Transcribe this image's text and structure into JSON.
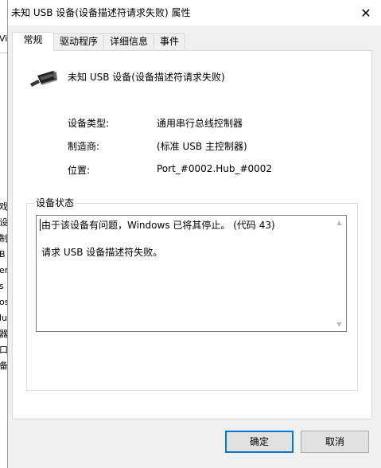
{
  "background_window": {
    "fragments": [
      "Vi",
      "戏",
      "设",
      "制",
      "B",
      "er",
      "s",
      "os",
      "lu",
      "器",
      "口",
      "备"
    ]
  },
  "window": {
    "title": "未知 USB 设备(设备描述符请求失败) 属性",
    "close_glyph": "✕"
  },
  "tabs": [
    {
      "label": "常规",
      "active": true
    },
    {
      "label": "驱动程序",
      "active": false
    },
    {
      "label": "详细信息",
      "active": false
    },
    {
      "label": "事件",
      "active": false
    }
  ],
  "device": {
    "icon": "usb-connector-icon",
    "name": "未知 USB 设备(设备描述符请求失败)"
  },
  "properties": [
    {
      "label": "设备类型:",
      "value": "通用串行总线控制器"
    },
    {
      "label": "制造商:",
      "value": "(标准 USB 主控制器)"
    },
    {
      "label": "位置:",
      "value": "Port_#0002.Hub_#0002"
    }
  ],
  "status": {
    "group_title": "设备状态",
    "lines": [
      "由于该设备有问题，Windows 已将其停止。 (代码 43)",
      "请求 USB 设备描述符失败。"
    ]
  },
  "buttons": {
    "ok": "确定",
    "cancel": "取消"
  },
  "colors": {
    "dialog_bg": "#f0f0f0",
    "panel_bg": "#ffffff",
    "default_button_border": "#0078d7",
    "button_bg": "#e1e1e1"
  }
}
